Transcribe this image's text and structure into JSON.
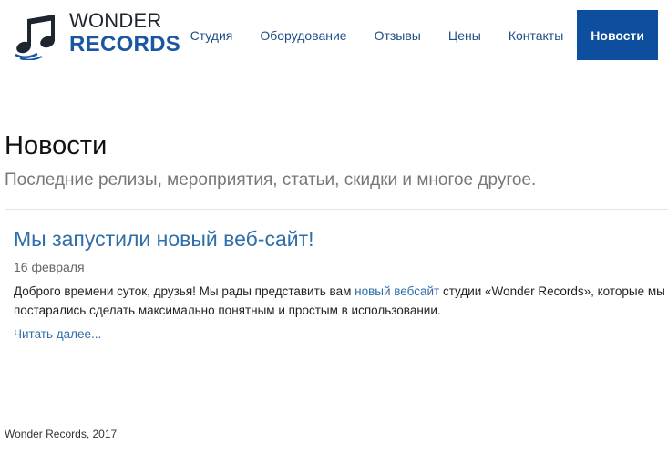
{
  "brand": {
    "line1": "WONDER",
    "line2": "RECORDS",
    "icon": "music-note-icon",
    "colors": {
      "dark": "#1f2530",
      "blue": "#1a57a3"
    }
  },
  "nav": {
    "items": [
      {
        "label": "Студия"
      },
      {
        "label": "Оборудование"
      },
      {
        "label": "Отзывы"
      },
      {
        "label": "Цены"
      },
      {
        "label": "Контакты"
      },
      {
        "label": "Новости",
        "active": true
      }
    ],
    "active_color": "#0d4f9e"
  },
  "page": {
    "title": "Новости",
    "subtitle": "Последние релизы, мероприятия, статьи, скидки и многое другое."
  },
  "post": {
    "title": "Мы запустили новый веб-сайт!",
    "date": "16 февраля",
    "text_before": "Доброго времени суток, друзья! Мы рады представить вам ",
    "link_text": "новый вебсайт",
    "text_after": " студии «Wonder Records», которые мы постарались сделать максимально понятным и простым в использовании.",
    "read_more": "Читать далее..."
  },
  "footer": {
    "text": "Wonder Records, 2017"
  }
}
